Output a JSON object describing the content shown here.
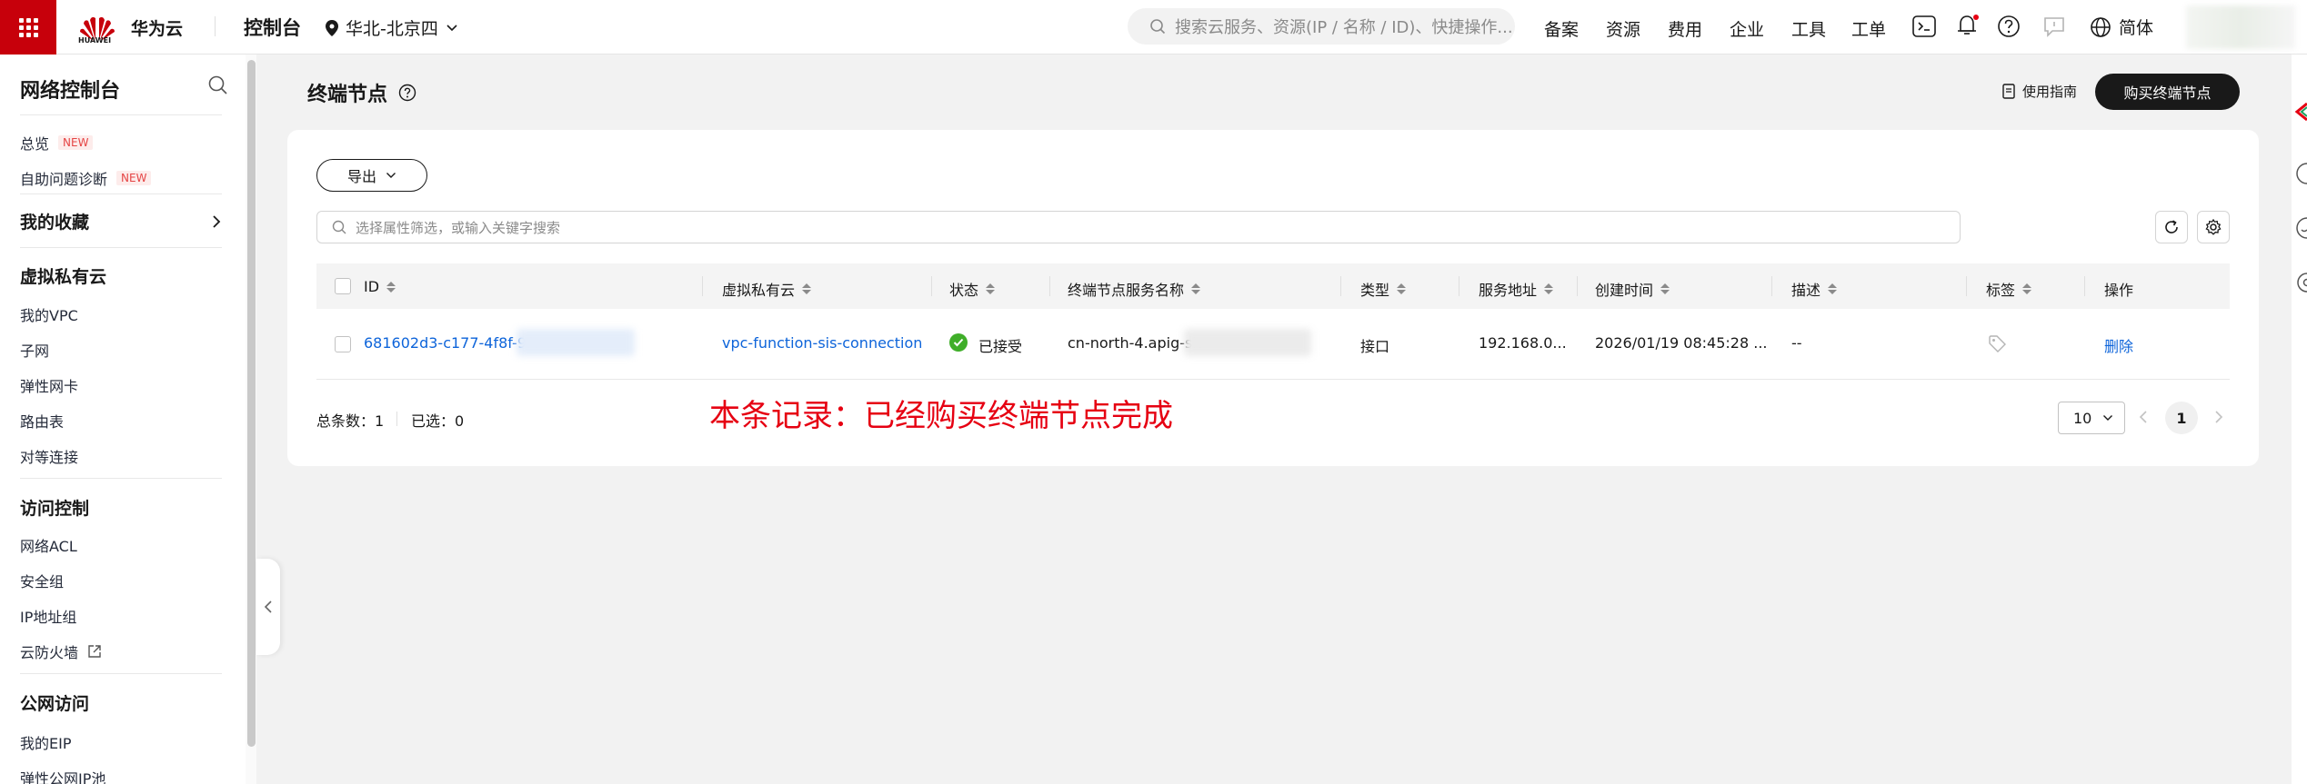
{
  "topbar": {
    "brand_logo_text": "HUAWEI",
    "brand": "华为云",
    "console": "控制台",
    "region": "华北-北京四",
    "search_placeholder": "搜索云服务、资源(IP / 名称 / ID)、快捷操作...",
    "nav": [
      "备案",
      "资源",
      "费用",
      "企业",
      "工具",
      "工单"
    ],
    "language": "简体",
    "accent_color": "#c7000b"
  },
  "sidebar": {
    "title": "网络控制台",
    "items_top": [
      {
        "label": "总览",
        "badge": "NEW"
      },
      {
        "label": "自助问题诊断",
        "badge": "NEW"
      }
    ],
    "favorites": "我的收藏",
    "sections": [
      {
        "title": "虚拟私有云",
        "items": [
          "我的VPC",
          "子网",
          "弹性网卡",
          "路由表",
          "对等连接"
        ]
      },
      {
        "title": "访问控制",
        "items": [
          "网络ACL",
          "安全组",
          "IP地址组",
          "云防火墙"
        ]
      },
      {
        "title": "公网访问",
        "items": [
          "我的EIP",
          "弹性公网IP池"
        ]
      }
    ]
  },
  "main": {
    "page_title": "终端节点",
    "guide": "使用指南",
    "buy_button": "购买终端节点",
    "export_button": "导出",
    "filter_placeholder": "选择属性筛选，或输入关键字搜索",
    "columns": [
      "ID",
      "虚拟私有云",
      "状态",
      "终端节点服务名称",
      "类型",
      "服务地址",
      "创建时间",
      "描述",
      "标签",
      "操作"
    ],
    "rows": [
      {
        "id": "681602d3-c177-4f8f-9f8",
        "vpc": "vpc-function-sis-connection",
        "status": "已接受",
        "service_name": "cn-north-4.apig-sis",
        "type": "接口",
        "address": "192.168.0...",
        "created": "2026/01/19 08:45:28 ...",
        "description": "--",
        "action": "删除"
      }
    ],
    "total_label": "总条数：",
    "total": "1",
    "selected_label": "已选：",
    "selected": "0",
    "page_size": "10",
    "current_page": "1",
    "annotation": "本条记录：已经购买终端节点完成"
  }
}
